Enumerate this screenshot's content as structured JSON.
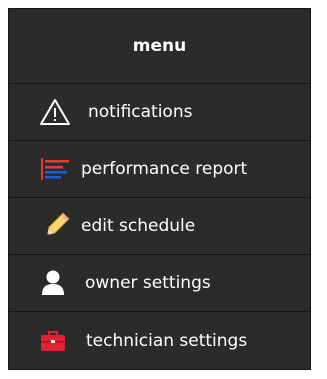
{
  "menu": {
    "title": "menu",
    "items": [
      {
        "id": "notifications",
        "label": "notifications",
        "icon": "warning-triangle-icon"
      },
      {
        "id": "performance-report",
        "label": "performance report",
        "icon": "report-lines-icon",
        "colors": [
          "#e53935",
          "#1e5bd6"
        ]
      },
      {
        "id": "edit-schedule",
        "label": "edit schedule",
        "icon": "pencil-icon",
        "colors": [
          "#f7d774",
          "#e6a800"
        ]
      },
      {
        "id": "owner-settings",
        "label": "owner settings",
        "icon": "person-icon"
      },
      {
        "id": "technician-settings",
        "label": "technician settings",
        "icon": "toolbox-icon",
        "colors": [
          "#e02232"
        ]
      }
    ]
  }
}
